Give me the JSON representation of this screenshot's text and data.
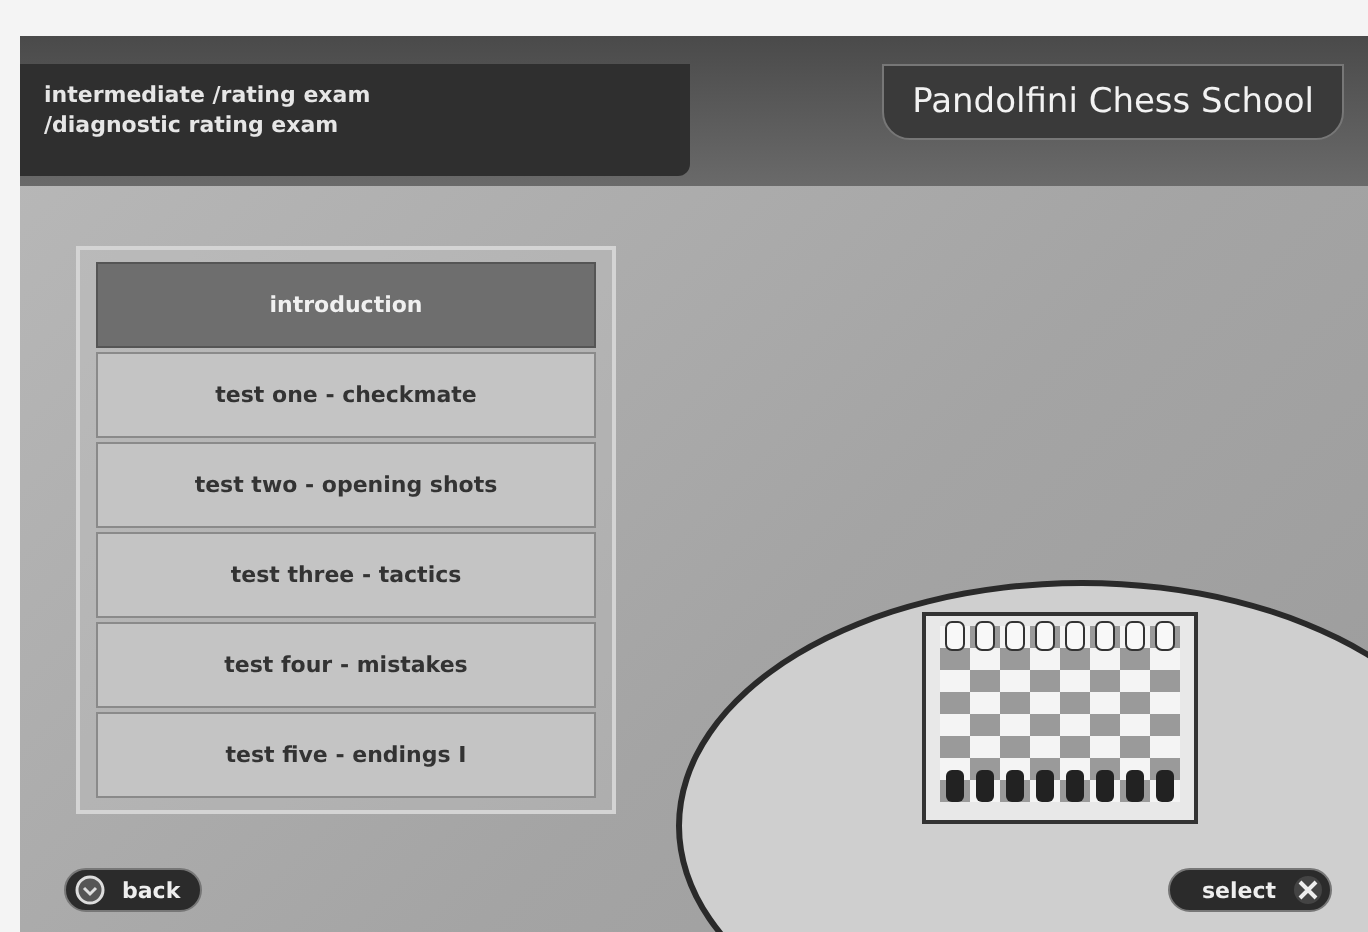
{
  "header": {
    "breadcrumb": [
      "intermediate /rating exam",
      "/diagnostic rating exam"
    ],
    "title": "Pandolfini Chess School"
  },
  "menu": [
    {
      "label": "introduction",
      "selected": true
    },
    {
      "label": "test one - checkmate",
      "selected": false
    },
    {
      "label": "test two - opening shots",
      "selected": false
    },
    {
      "label": "test three - tactics",
      "selected": false
    },
    {
      "label": "test four - mistakes",
      "selected": false
    },
    {
      "label": "test five - endings I",
      "selected": false
    }
  ],
  "footer": {
    "back": "back",
    "select": "select"
  }
}
